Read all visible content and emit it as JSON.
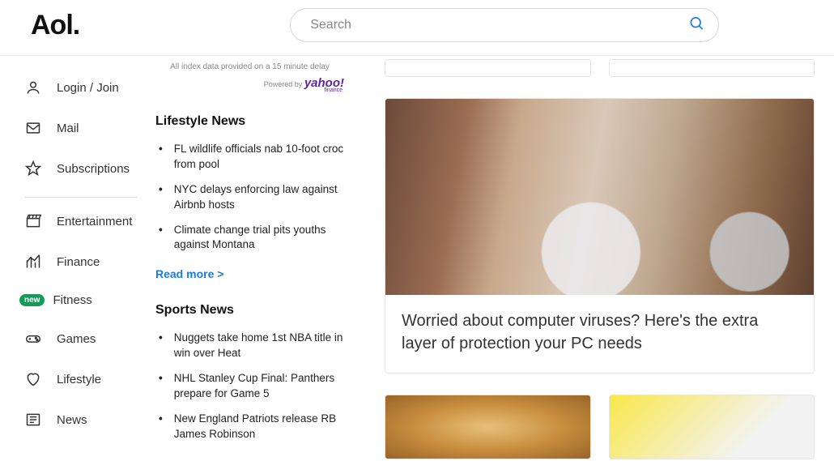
{
  "logo": "Aol.",
  "search": {
    "placeholder": "Search"
  },
  "nav": {
    "login": "Login / Join",
    "mail": "Mail",
    "subscriptions": "Subscriptions",
    "entertainment": "Entertainment",
    "finance": "Finance",
    "fitness": "Fitness",
    "fitness_badge": "new",
    "games": "Games",
    "lifestyle": "Lifestyle",
    "news": "News"
  },
  "middle": {
    "index_note": "All index data provided on a 15 minute delay",
    "powered_prefix": "Powered by",
    "powered_brand": "yahoo!",
    "powered_sub": "finance",
    "lifestyle_title": "Lifestyle News",
    "lifestyle_items": {
      "0": "FL wildlife officials nab 10-foot croc from pool",
      "1": "NYC delays enforcing law against Airbnb hosts",
      "2": "Climate change trial pits youths against Montana"
    },
    "read_more": "Read more >",
    "sports_title": "Sports News",
    "sports_items": {
      "0": "Nuggets take home 1st NBA title in win over Heat",
      "1": "NHL Stanley Cup Final: Panthers prepare for Game 5",
      "2": "New England Patriots release RB James Robinson"
    }
  },
  "hero": {
    "title": "Worried about computer viruses? Here's the extra layer of protection your PC needs"
  }
}
